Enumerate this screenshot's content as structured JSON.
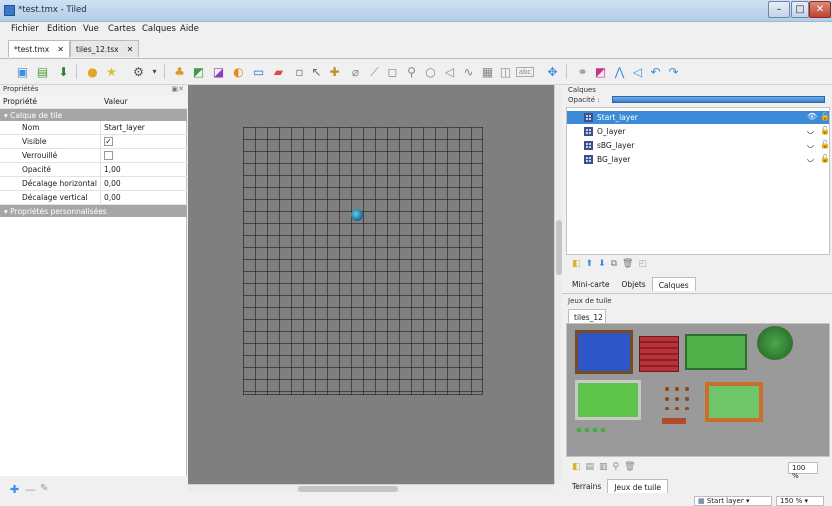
{
  "window": {
    "title": "*test.tmx - Tiled"
  },
  "menu": [
    "Fichier",
    "Edition",
    "Vue",
    "Cartes",
    "Calques",
    "Aide"
  ],
  "doc_tabs": [
    {
      "label": "*test.tmx",
      "close": "✕"
    },
    {
      "label": "tiles_12.tsx",
      "close": "✕"
    }
  ],
  "toolbar_icons": [
    "new-map-icon",
    "open-icon",
    "save-icon",
    "open-tileset-icon",
    "favorite-icon",
    "command-icon",
    "stamp-brush-icon",
    "terrain-brush-icon",
    "bucket-fill-icon",
    "shape-fill-icon",
    "eraser-icon",
    "rectangle-select-icon",
    "magic-wand-icon",
    "select-same-tile-icon",
    "select-objects-icon",
    "edit-polygons-icon",
    "insert-rectangle-icon",
    "insert-ellipse-icon",
    "insert-polygon-icon",
    "insert-polyline-icon",
    "insert-tile-icon",
    "insert-text-icon",
    "random-mode-icon",
    "flip-horizontal-icon",
    "flip-vertical-icon",
    "rotate-left-icon",
    "rotate-right-icon"
  ],
  "properties": {
    "dock_title": "Propriétés",
    "col_property": "Propriété",
    "col_value": "Valeur",
    "section": "Calque de tile",
    "rows": [
      {
        "key": "Nom",
        "value": "Start_layer"
      },
      {
        "key": "Visible",
        "value": "✓"
      },
      {
        "key": "Verrouillé",
        "value": ""
      },
      {
        "key": "Opacité",
        "value": "1,00"
      },
      {
        "key": "Décalage horizontal",
        "value": "0,00"
      },
      {
        "key": "Décalage vertical",
        "value": "0,00"
      }
    ],
    "custom_section": "Propriétés personnalisées",
    "footer_icons": [
      "add-property-icon",
      "remove-property-icon",
      "rename-property-icon"
    ]
  },
  "layers_panel": {
    "dock_title": "Calques",
    "opacity_label": "Opacité :",
    "opacity": 1.0,
    "layers": [
      {
        "name": "Start_layer",
        "selected": true
      },
      {
        "name": "O_layer",
        "selected": false
      },
      {
        "name": "sBG_layer",
        "selected": false
      },
      {
        "name": "BG_layer",
        "selected": false
      }
    ],
    "tabs": [
      "Mini-carte",
      "Objets",
      "Calques"
    ],
    "active_tab": "Calques"
  },
  "tilesets_panel": {
    "dock_title": "Jeux de tuile",
    "tileset_tab": "tiles_12",
    "zoom": "100 %",
    "tabs": [
      "Terrains",
      "Jeux de tuile"
    ],
    "active_tab": "Jeux de tuile"
  },
  "status": {
    "layer": "Start layer",
    "zoom": "150 %"
  },
  "colors": {
    "selection": "#3c8ad8",
    "canvas": "#7f7f7f",
    "grid": "#2a2a2a"
  }
}
